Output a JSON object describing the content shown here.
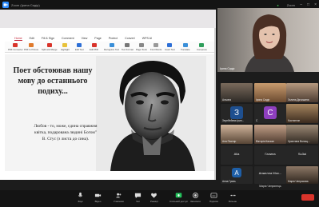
{
  "window": {
    "title": "Zoom (Ірина Сидір)",
    "status_right": "Zoom",
    "controls": [
      "–",
      "□",
      "×"
    ]
  },
  "pdf_app": {
    "menus": [
      "Home",
      "Edit",
      "Fill & Sign",
      "Comment",
      "View",
      "Page",
      "Protect",
      "Convert",
      "Fill & Sign",
      "WPS AI"
    ],
    "active_menu": "Home",
    "tools": [
      "PDF Converter",
      "PDF to Picture",
      "Split and Merge",
      "Highlight",
      "Edit Text",
      "Edit PDF",
      "Recognize Text",
      "Text Format",
      "Page Tools",
      "Find Words",
      "Insert Text",
      "Translate",
      "Compress"
    ]
  },
  "slide": {
    "poem_lines": [
      "Поет обстоював нашу",
      "мову до останнього",
      "подиху..."
    ],
    "quote_lines": [
      "Любов - то, може, єдина справжня",
      "квітка, подарована людині Богом\"",
      "В. Стус (з листа до сина)."
    ]
  },
  "speaker": {
    "name": "Ірина Сидір"
  },
  "participants": [
    {
      "name": "Альона",
      "kind": "video"
    },
    {
      "name": "Ірина Сидір",
      "kind": "video"
    },
    {
      "name": "Зеунбейева Ірин...",
      "kind": "initial",
      "initial": "З",
      "color": "#1e4f8f"
    },
    {
      "name": "C",
      "kind": "initial",
      "initial": "C",
      "color": "#8f3fbf"
    },
    {
      "name": "Галина Дячишина",
      "kind": "video"
    },
    {
      "name": "Ала Пастир",
      "kind": "video"
    },
    {
      "name": "Вікторія Касьян",
      "kind": "video"
    },
    {
      "name": "Костянтин",
      "kind": "video"
    },
    {
      "name": "Alla",
      "kind": "name"
    },
    {
      "name": "Галина",
      "kind": "name"
    },
    {
      "name": "Христина Волощ...",
      "kind": "video"
    },
    {
      "name": "Анна Гринь",
      "kind": "initial",
      "initial": "A",
      "color": "#1e5fa8"
    },
    {
      "name": "Анжелла Мос...",
      "kind": "name"
    },
    {
      "name": "Su3ai",
      "kind": "name"
    },
    {
      "name": "Марія Чепрасова",
      "kind": "name"
    },
    {
      "name": "Марія Чепринець",
      "kind": "name"
    }
  ],
  "toolbar": {
    "items": [
      "Звук",
      "Відео",
      "Учасники",
      "Чат",
      "Реакції",
      "Спільний доступ",
      "Записати",
      "Підписи",
      "Більше"
    ],
    "end_label": ""
  }
}
